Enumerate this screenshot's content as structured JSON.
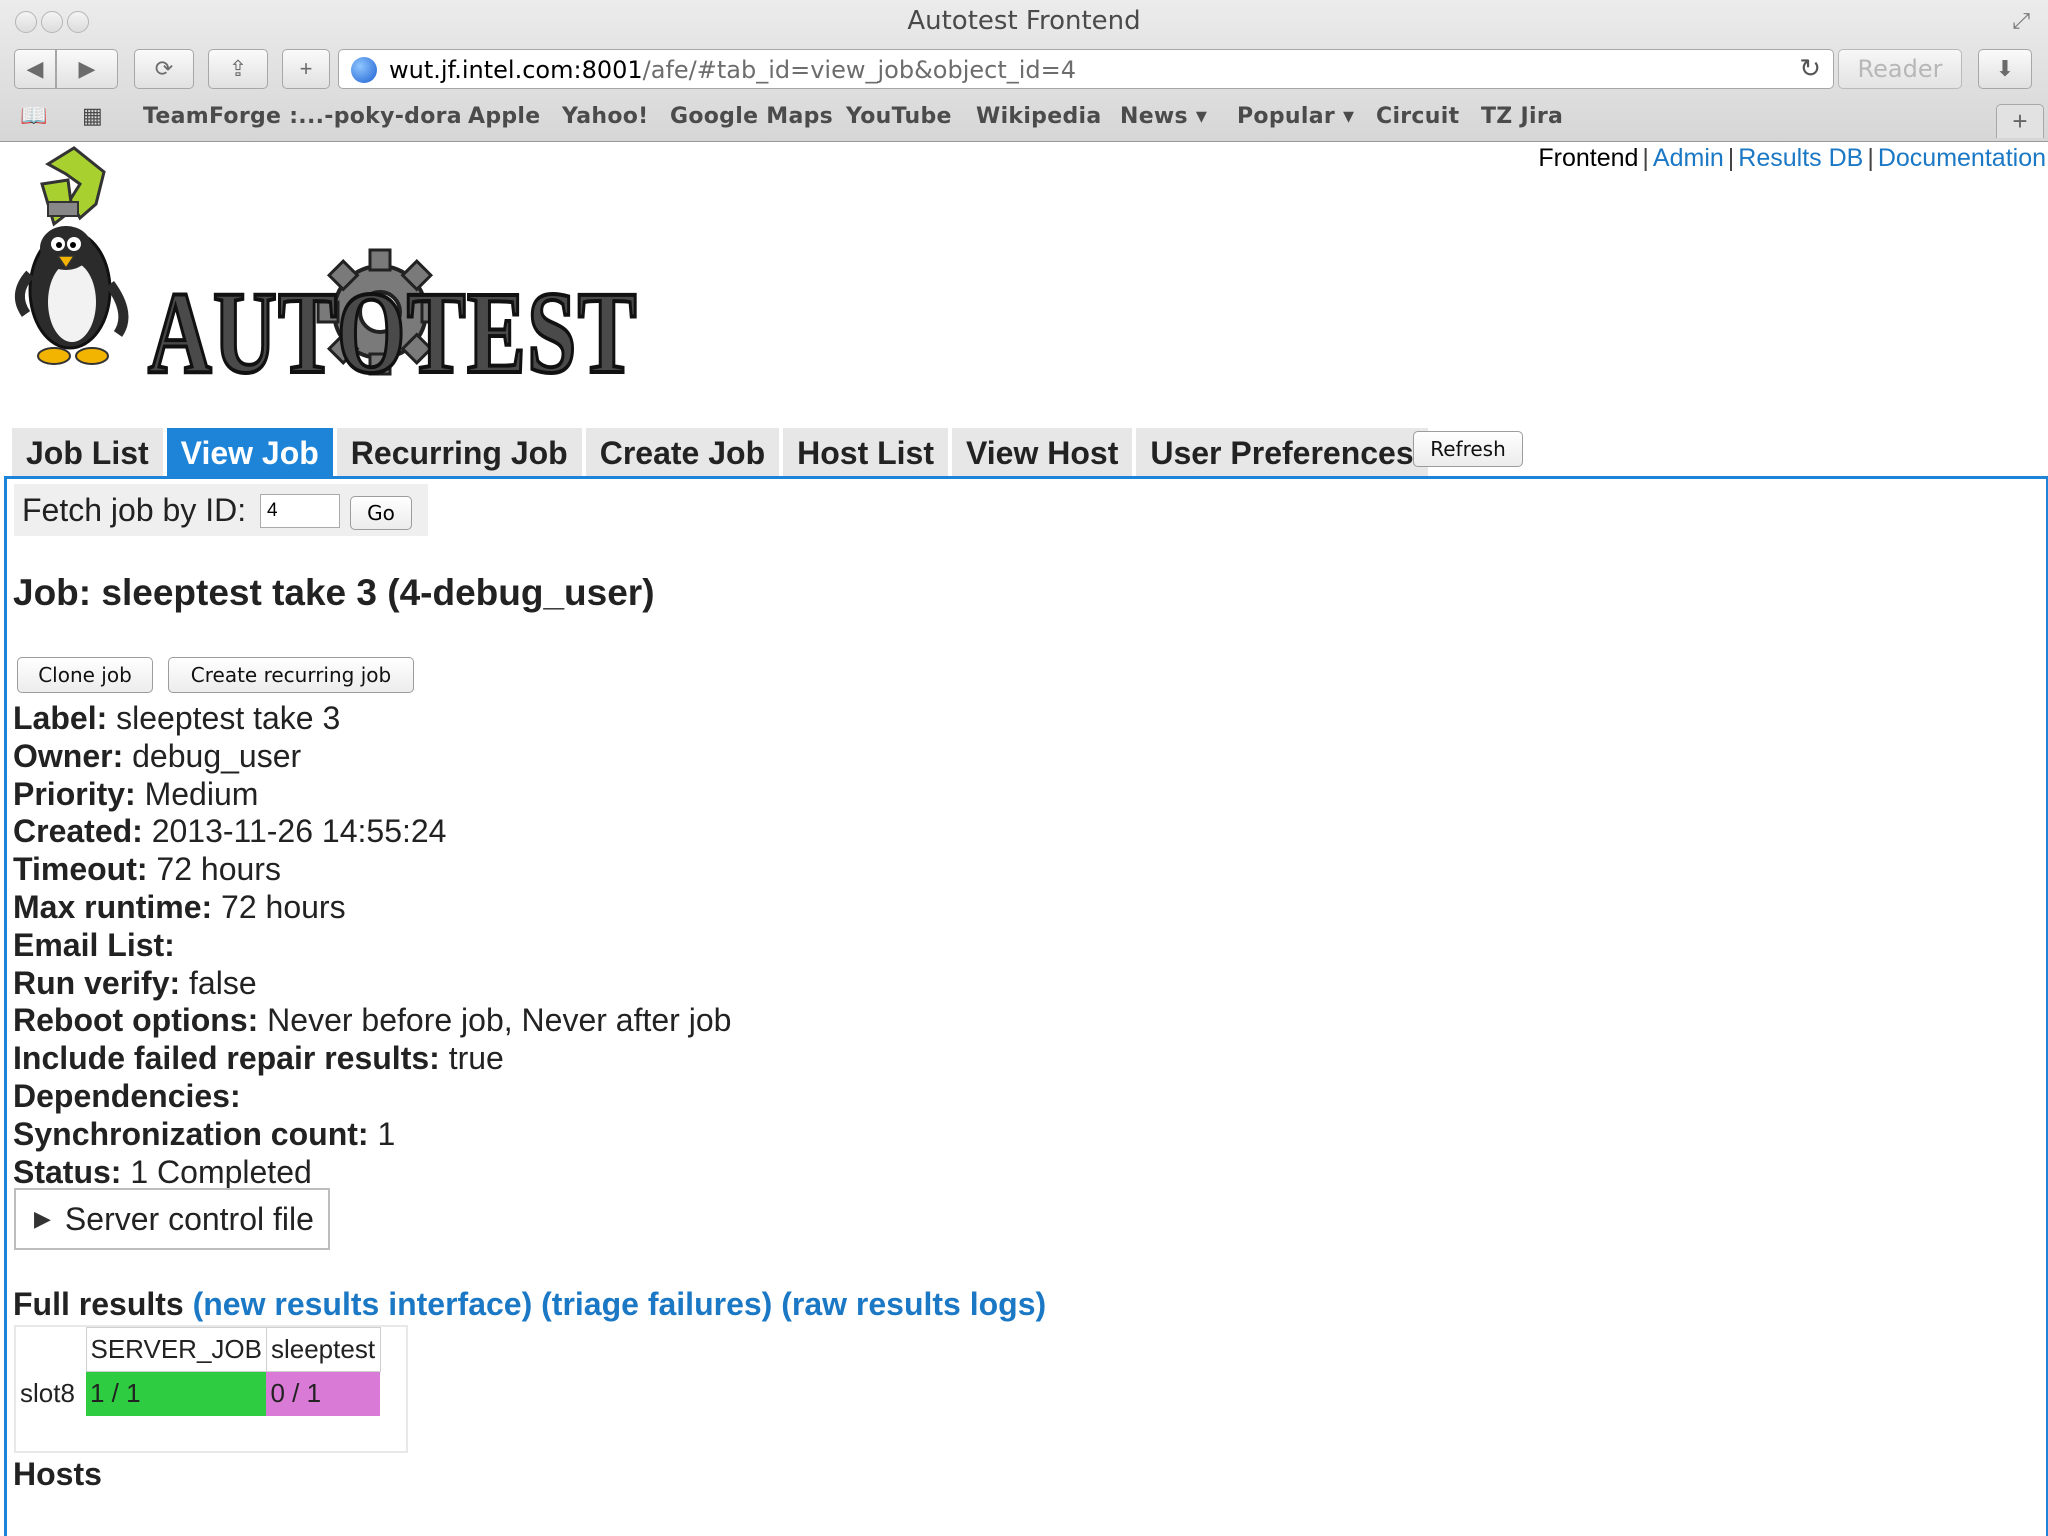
{
  "browser": {
    "window_title": "Autotest Frontend",
    "url_host": "wut.jf.intel.com:8001",
    "url_path": "/afe/#tab_id=view_job&object_id=4",
    "reader_label": "Reader",
    "bookmarks": [
      "TeamForge :...-poky-dora",
      "Apple",
      "Yahoo!",
      "Google Maps",
      "YouTube",
      "Wikipedia",
      "News ▾",
      "Popular ▾",
      "Circuit",
      "TZ Jira"
    ]
  },
  "top_links": {
    "frontend": "Frontend",
    "admin": "Admin",
    "results_db": "Results DB",
    "documentation": "Documentation",
    "separator": "|"
  },
  "logo_text": "AUTOTEST",
  "tabs": [
    "Job List",
    "View Job",
    "Recurring Job",
    "Create Job",
    "Host List",
    "View Host",
    "User Preferences"
  ],
  "active_tab": "View Job",
  "refresh_label": "Refresh",
  "fetch": {
    "label": "Fetch job by ID:",
    "value": "4",
    "go_label": "Go"
  },
  "job_title": "Job: sleeptest take 3 (4-debug_user)",
  "buttons": {
    "clone": "Clone job",
    "recurring": "Create recurring job"
  },
  "details": [
    {
      "label": "Label:",
      "value": "sleeptest take 3"
    },
    {
      "label": "Owner:",
      "value": "debug_user"
    },
    {
      "label": "Priority:",
      "value": "Medium"
    },
    {
      "label": "Created:",
      "value": "2013-11-26 14:55:24"
    },
    {
      "label": "Timeout:",
      "value": "72 hours"
    },
    {
      "label": "Max runtime:",
      "value": "72 hours"
    },
    {
      "label": "Email List:",
      "value": ""
    },
    {
      "label": "Run verify:",
      "value": "false"
    },
    {
      "label": "Reboot options:",
      "value": "Never before job, Never after job"
    },
    {
      "label": "Include failed repair results:",
      "value": "true"
    },
    {
      "label": "Dependencies:",
      "value": ""
    },
    {
      "label": "Synchronization count:",
      "value": "1"
    },
    {
      "label": "Status:",
      "value": "1 Completed"
    }
  ],
  "server_control_label": "Server control file",
  "full_results": {
    "label": "Full results",
    "links": [
      "(new results interface)",
      "(triage failures)",
      "(raw results logs)"
    ]
  },
  "results_table": {
    "columns": [
      "SERVER_JOB",
      "sleeptest"
    ],
    "rows": [
      {
        "host": "slot8",
        "cells": [
          "1 / 1",
          "0 / 1"
        ]
      }
    ],
    "colors": {
      "pass": "#2ecc40",
      "fail": "#d97ad6"
    }
  },
  "hosts_heading": "Hosts",
  "colors": {
    "accent": "#1d84d8",
    "link": "#1b78c5"
  }
}
